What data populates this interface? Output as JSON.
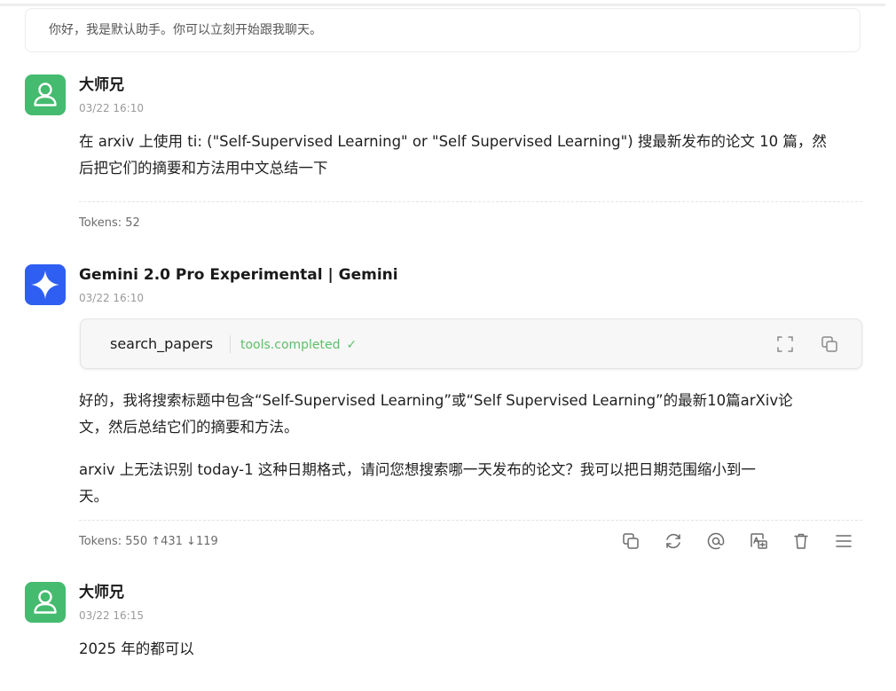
{
  "welcome": {
    "text": "你好，我是默认助手。你可以立刻开始跟我聊天。"
  },
  "messages": {
    "m1": {
      "name": "大师兄",
      "time": "03/22 16:10",
      "body": [
        "在 arxiv 上使用 ti: (\"Self-Supervised Learning\" or \"Self Supervised Learning\") 搜最新发布的论文 10 篇，然",
        "后把它们的摘要和方法用中文总结一下"
      ],
      "tokens": "Tokens: 52"
    },
    "m2": {
      "name": "Gemini 2.0 Pro Experimental | Gemini",
      "time": "03/22 16:10",
      "tool": {
        "name": "search_papers",
        "status": "tools.completed",
        "check": "✓"
      },
      "para1": [
        "好的，我将搜索标题中包含“Self-Supervised Learning”或“Self Supervised Learning”的最新10篇arXiv论",
        "文，然后总结它们的摘要和方法。"
      ],
      "para2": [
        "arxiv 上无法识别 today-1 这种日期格式，请问您想搜索哪一天发布的论文？我可以把日期范围缩小到一",
        "天。"
      ],
      "tokens": "Tokens: 550 ↑431 ↓119"
    },
    "m3": {
      "name": "大师兄",
      "time": "03/22 16:15",
      "body": "2025 年的都可以"
    }
  },
  "icons": {
    "avatar_user": "user-icon",
    "avatar_gemini": "gemini-sparkle-icon",
    "tool_actions": [
      "expand-icon",
      "copy-icon"
    ],
    "message_actions": [
      "copy-icon",
      "regenerate-icon",
      "mention-icon",
      "translate-icon",
      "delete-icon",
      "menu-icon"
    ]
  },
  "colors": {
    "user_avatar": "#44bb6e",
    "gemini_avatar": "#2f5ff2",
    "tool_status": "#5fbf6a"
  }
}
